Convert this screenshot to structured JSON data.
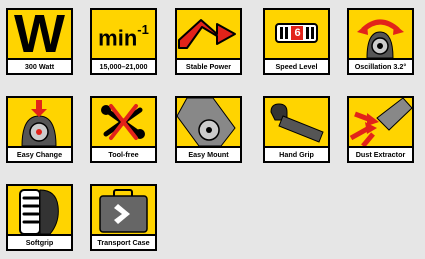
{
  "features": [
    {
      "label": "300 Watt",
      "icon": "power-watt-icon",
      "glyph": "W"
    },
    {
      "label": "15,000–21,000",
      "icon": "rpm-icon",
      "glyph": "min",
      "sup": "-1"
    },
    {
      "label": "Stable Power",
      "icon": "stable-power-arrow-icon"
    },
    {
      "label": "Speed Level",
      "icon": "speed-level-icon",
      "value": "6"
    },
    {
      "label": "Oscillation 3.2°",
      "icon": "oscillation-icon"
    },
    {
      "label": "Easy Change",
      "icon": "easy-change-icon"
    },
    {
      "label": "Tool-free",
      "icon": "tool-free-icon"
    },
    {
      "label": "Easy Mount",
      "icon": "easy-mount-icon"
    },
    {
      "label": "Hand Grip",
      "icon": "hand-grip-icon"
    },
    {
      "label": "Dust Extractor",
      "icon": "dust-extractor-icon"
    },
    {
      "label": "Softgrip",
      "icon": "softgrip-icon"
    },
    {
      "label": "Transport Case",
      "icon": "transport-case-icon"
    }
  ],
  "colors": {
    "accent": "#ffd400",
    "ink": "#000000",
    "arrow": "#e2231a",
    "background": "#e6e6e6"
  }
}
